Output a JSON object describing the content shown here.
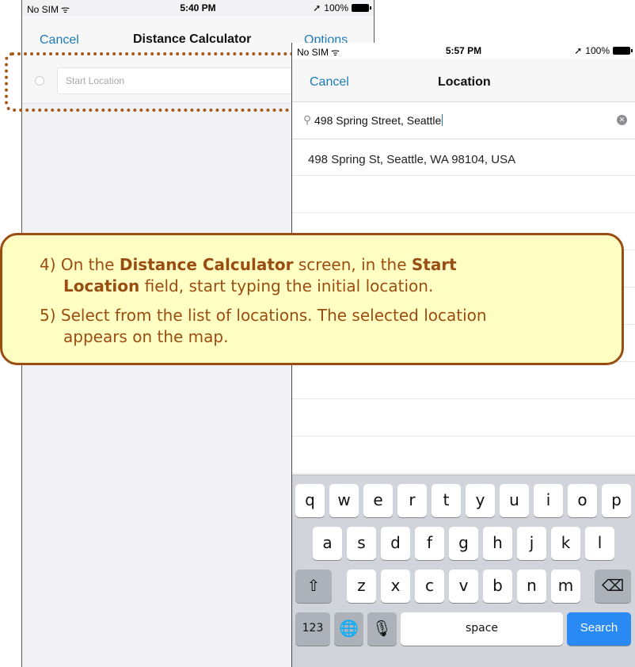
{
  "back_screen": {
    "status": {
      "carrier": "No SIM",
      "time": "5:40 PM",
      "battery": "100%"
    },
    "nav": {
      "cancel": "Cancel",
      "title": "Distance Calculator",
      "options": "Options"
    },
    "start_location_placeholder": "Start Location"
  },
  "front_screen": {
    "status": {
      "carrier": "No SIM",
      "time": "5:57 PM",
      "battery": "100%"
    },
    "nav": {
      "cancel": "Cancel",
      "title": "Location"
    },
    "search_value": "498 Spring Street, Seattle",
    "results": [
      "498 Spring St, Seattle, WA 98104, USA"
    ],
    "keyboard": {
      "row1": [
        "q",
        "w",
        "e",
        "r",
        "t",
        "y",
        "u",
        "i",
        "o",
        "p"
      ],
      "row2": [
        "a",
        "s",
        "d",
        "f",
        "g",
        "h",
        "j",
        "k",
        "l"
      ],
      "row3": [
        "z",
        "x",
        "c",
        "v",
        "b",
        "n",
        "m"
      ],
      "numbers": "123",
      "space": "space",
      "search": "Search"
    }
  },
  "callout": {
    "step4": {
      "prefix": "4) On the ",
      "bold1": "Distance Calculator",
      "mid": " screen, in the ",
      "bold2a": "Start",
      "bold2b": "Location",
      "suffix": " field, start typing the initial location."
    },
    "step5": {
      "line1": "5) Select from the list of locations. The selected location",
      "line2": "appears on the map."
    }
  },
  "colors": {
    "accent": "#1f7bb5",
    "callout_border": "#9a4d12",
    "callout_bg": "#ffffc3",
    "search_key": "#2a8af3"
  }
}
